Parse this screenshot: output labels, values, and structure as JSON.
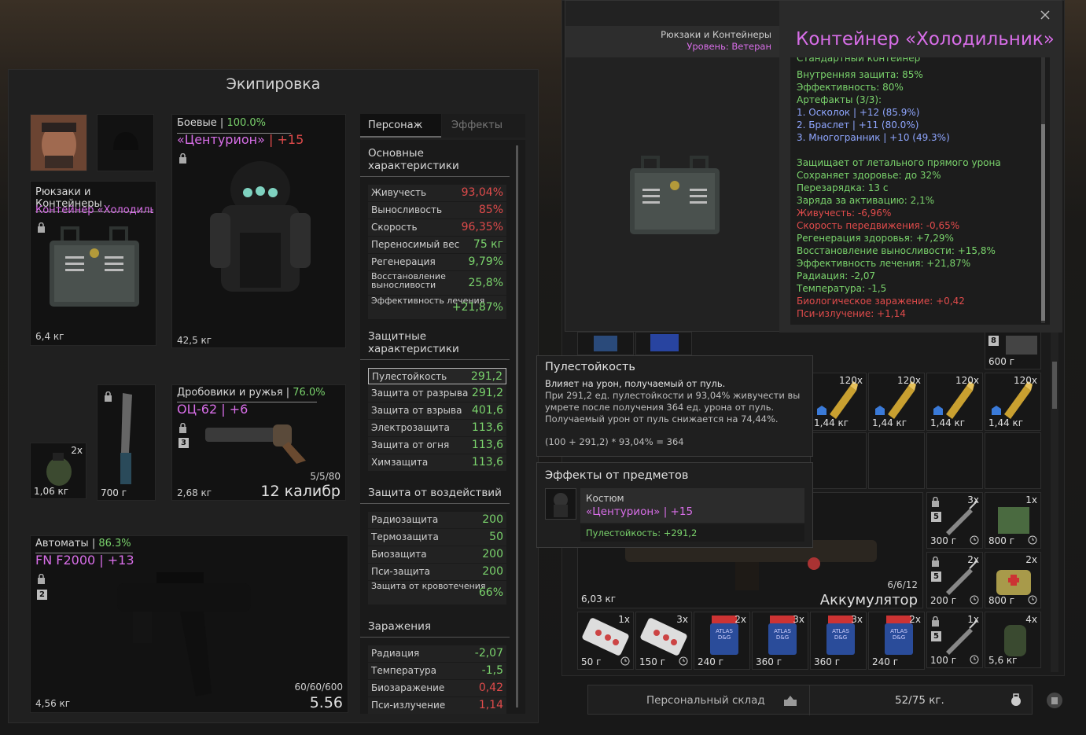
{
  "equipment": {
    "title": "Экипировка",
    "backpack": {
      "header": "Рюкзаки и Контейнеры",
      "name": "Контейнер «Холодильн..",
      "weight": "6,4 кг"
    },
    "armor": {
      "category": "Боевые",
      "percent": "100.0%",
      "name": "«Центурион»",
      "level": "+15",
      "weight": "42,5 кг"
    },
    "grenade": {
      "count": "2x",
      "weight": "1,06 кг"
    },
    "knife": {
      "weight": "700 г"
    },
    "shotgun": {
      "category": "Дробовики и ружья",
      "percent": "76.0%",
      "name": "ОЦ-62",
      "level": "+6",
      "badge": "3",
      "weight": "2,68 кг",
      "ammo": "5/5/80",
      "caliber": "12 калибр"
    },
    "rifle": {
      "category": "Автоматы",
      "percent": "86.3%",
      "name": "FN F2000",
      "level": "+13",
      "badge": "2",
      "weight": "4,56 кг",
      "ammo": "60/60/600",
      "caliber": "5.56"
    }
  },
  "tabs": {
    "character": "Персонаж",
    "effects": "Эффекты"
  },
  "stats": {
    "basic_title": "Основные характеристики",
    "basic": [
      {
        "k": "Живучесть",
        "v": "93,04%",
        "c": "red"
      },
      {
        "k": "Выносливость",
        "v": "85%",
        "c": "red"
      },
      {
        "k": "Скорость",
        "v": "96,35%",
        "c": "red"
      },
      {
        "k": "Переносимый вес",
        "v": "75 кг",
        "c": "green"
      },
      {
        "k": "Регенерация",
        "v": "9,79%",
        "c": "green"
      }
    ],
    "stamina_regen": {
      "k": "Восстановление выносливости",
      "v": "25,8%"
    },
    "heal_eff": {
      "k": "Эффективность лечения",
      "v": "+21,87%"
    },
    "protect_title": "Защитные характеристики",
    "protect": [
      {
        "k": "Пулестойкость",
        "v": "291,2"
      },
      {
        "k": "Защита от разрыва",
        "v": "291,2"
      },
      {
        "k": "Защита от взрыва",
        "v": "401,6"
      },
      {
        "k": "Электрозащита",
        "v": "113,6"
      },
      {
        "k": "Защита от огня",
        "v": "113,6"
      },
      {
        "k": "Химзащита",
        "v": "113,6"
      }
    ],
    "impact_title": "Защита от воздействий",
    "impact": [
      {
        "k": "Радиозащита",
        "v": "200"
      },
      {
        "k": "Термозащита",
        "v": "50"
      },
      {
        "k": "Биозащита",
        "v": "200"
      },
      {
        "k": "Пси-защита",
        "v": "200"
      }
    ],
    "bleed": {
      "k": "Защита от кровотечения",
      "v": "66%"
    },
    "infect_title": "Заражения",
    "infect": [
      {
        "k": "Радиация",
        "v": "-2,07",
        "c": "green"
      },
      {
        "k": "Температура",
        "v": "-1,5",
        "c": "green"
      },
      {
        "k": "Биозаражение",
        "v": "0,42",
        "c": "red"
      },
      {
        "k": "Пси-излучение",
        "v": "1,14",
        "c": "red"
      }
    ]
  },
  "container_tooltip": {
    "category": "Рюкзаки и Контейнеры",
    "tier": "Уровень: Ветеран",
    "title": "Контейнер «Холодильник»",
    "cut_line": "Стандартный контейнер",
    "lines_green": [
      "Внутренняя защита: 85%",
      "Эффективность: 80%",
      "Артефакты (3/3):"
    ],
    "artifacts": [
      {
        "name": "1. Осколок",
        "val": " | +12 (85.9%)"
      },
      {
        "name": "2. Браслет",
        "val": " | +11 (80.0%)"
      },
      {
        "name": "3. Многогранник",
        "val": " | +10 (49.3%)"
      }
    ],
    "effects": [
      {
        "t": "Защищает от летального прямого урона",
        "c": "green"
      },
      {
        "t": "Сохраняет здоровье: до 32%",
        "c": "green"
      },
      {
        "t": "Перезарядка: 13 с",
        "c": "green"
      },
      {
        "t": "Заряда за активацию: 2,1%",
        "c": "green"
      },
      {
        "t": "Живучесть: -6,96%",
        "c": "red"
      },
      {
        "t": "Скорость передвижения: -0,65%",
        "c": "red"
      },
      {
        "t": "Регенерация здоровья: +7,29%",
        "c": "green"
      },
      {
        "t": "Восстановление выносливости: +15,8%",
        "c": "green"
      },
      {
        "t": "Эффективность лечения: +21,87%",
        "c": "green"
      },
      {
        "t": "Радиация: -2,07",
        "c": "green"
      },
      {
        "t": "Температура: -1,5",
        "c": "green"
      },
      {
        "t": "Биологическое заражение: +0,42",
        "c": "red"
      },
      {
        "t": "Пси-излучение: +1,14",
        "c": "red"
      }
    ]
  },
  "bullet_tooltip": {
    "title": "Пулестойкость",
    "subtitle": "Влияет на урон, получаемый от пуль.",
    "desc": "При 291,2 ед. пулестойкости и 93,04% живучести вы умрете после получения 364 ед. урона от пуль. Получаемый урон от пуль снижается на 74,44%.",
    "formula": "(100 + 291,2) * 93,04% = 364"
  },
  "item_effects": {
    "title": "Эффекты от предметов",
    "type": "Костюм",
    "name": "«Центурион» | +15",
    "effect": "Пулестойкость: +291,2"
  },
  "inventory": {
    "ammo": [
      {
        "cnt": "120x",
        "wt": "1,44 кг"
      },
      {
        "cnt": "120x",
        "wt": "1,44 кг"
      },
      {
        "cnt": "120x",
        "wt": "1,44 кг"
      },
      {
        "cnt": "120x",
        "wt": "1,44 кг"
      }
    ],
    "top_right": {
      "badge": "8",
      "wt": "600 г"
    },
    "weapon": {
      "wt": "6,03 кг",
      "ammo": "6/6/12",
      "caliber": "Аккумулятор"
    },
    "syringes": [
      {
        "cnt": "3x",
        "badge": "5",
        "wt": "300 г"
      },
      {
        "cnt": "2x",
        "badge": "5",
        "wt": "200 г"
      },
      {
        "cnt": "1x",
        "badge": "5",
        "wt": "100 г"
      }
    ],
    "kits": [
      {
        "cnt": "1x",
        "wt": "800 г"
      },
      {
        "cnt": "2x",
        "wt": "800 г"
      },
      {
        "cnt": "4x",
        "wt": "5,6 кг"
      }
    ],
    "bottom": [
      {
        "cnt": "1x",
        "wt": "50 г"
      },
      {
        "cnt": "3x",
        "wt": "150 г"
      },
      {
        "cnt": "2x",
        "wt": "240 г"
      },
      {
        "cnt": "3x",
        "wt": "360 г"
      },
      {
        "cnt": "3x",
        "wt": "360 г"
      },
      {
        "cnt": "2x",
        "wt": "240 г"
      }
    ],
    "pill_label": "ATLAS D&G"
  },
  "footer": {
    "storage": "Персональный склад",
    "capacity": "52/75 кг."
  },
  "colors": {
    "pink": "#d86ee8",
    "red": "#e04b4b",
    "green": "#7ad36c",
    "blue": "#8fa6ff",
    "bg": "#202020"
  }
}
